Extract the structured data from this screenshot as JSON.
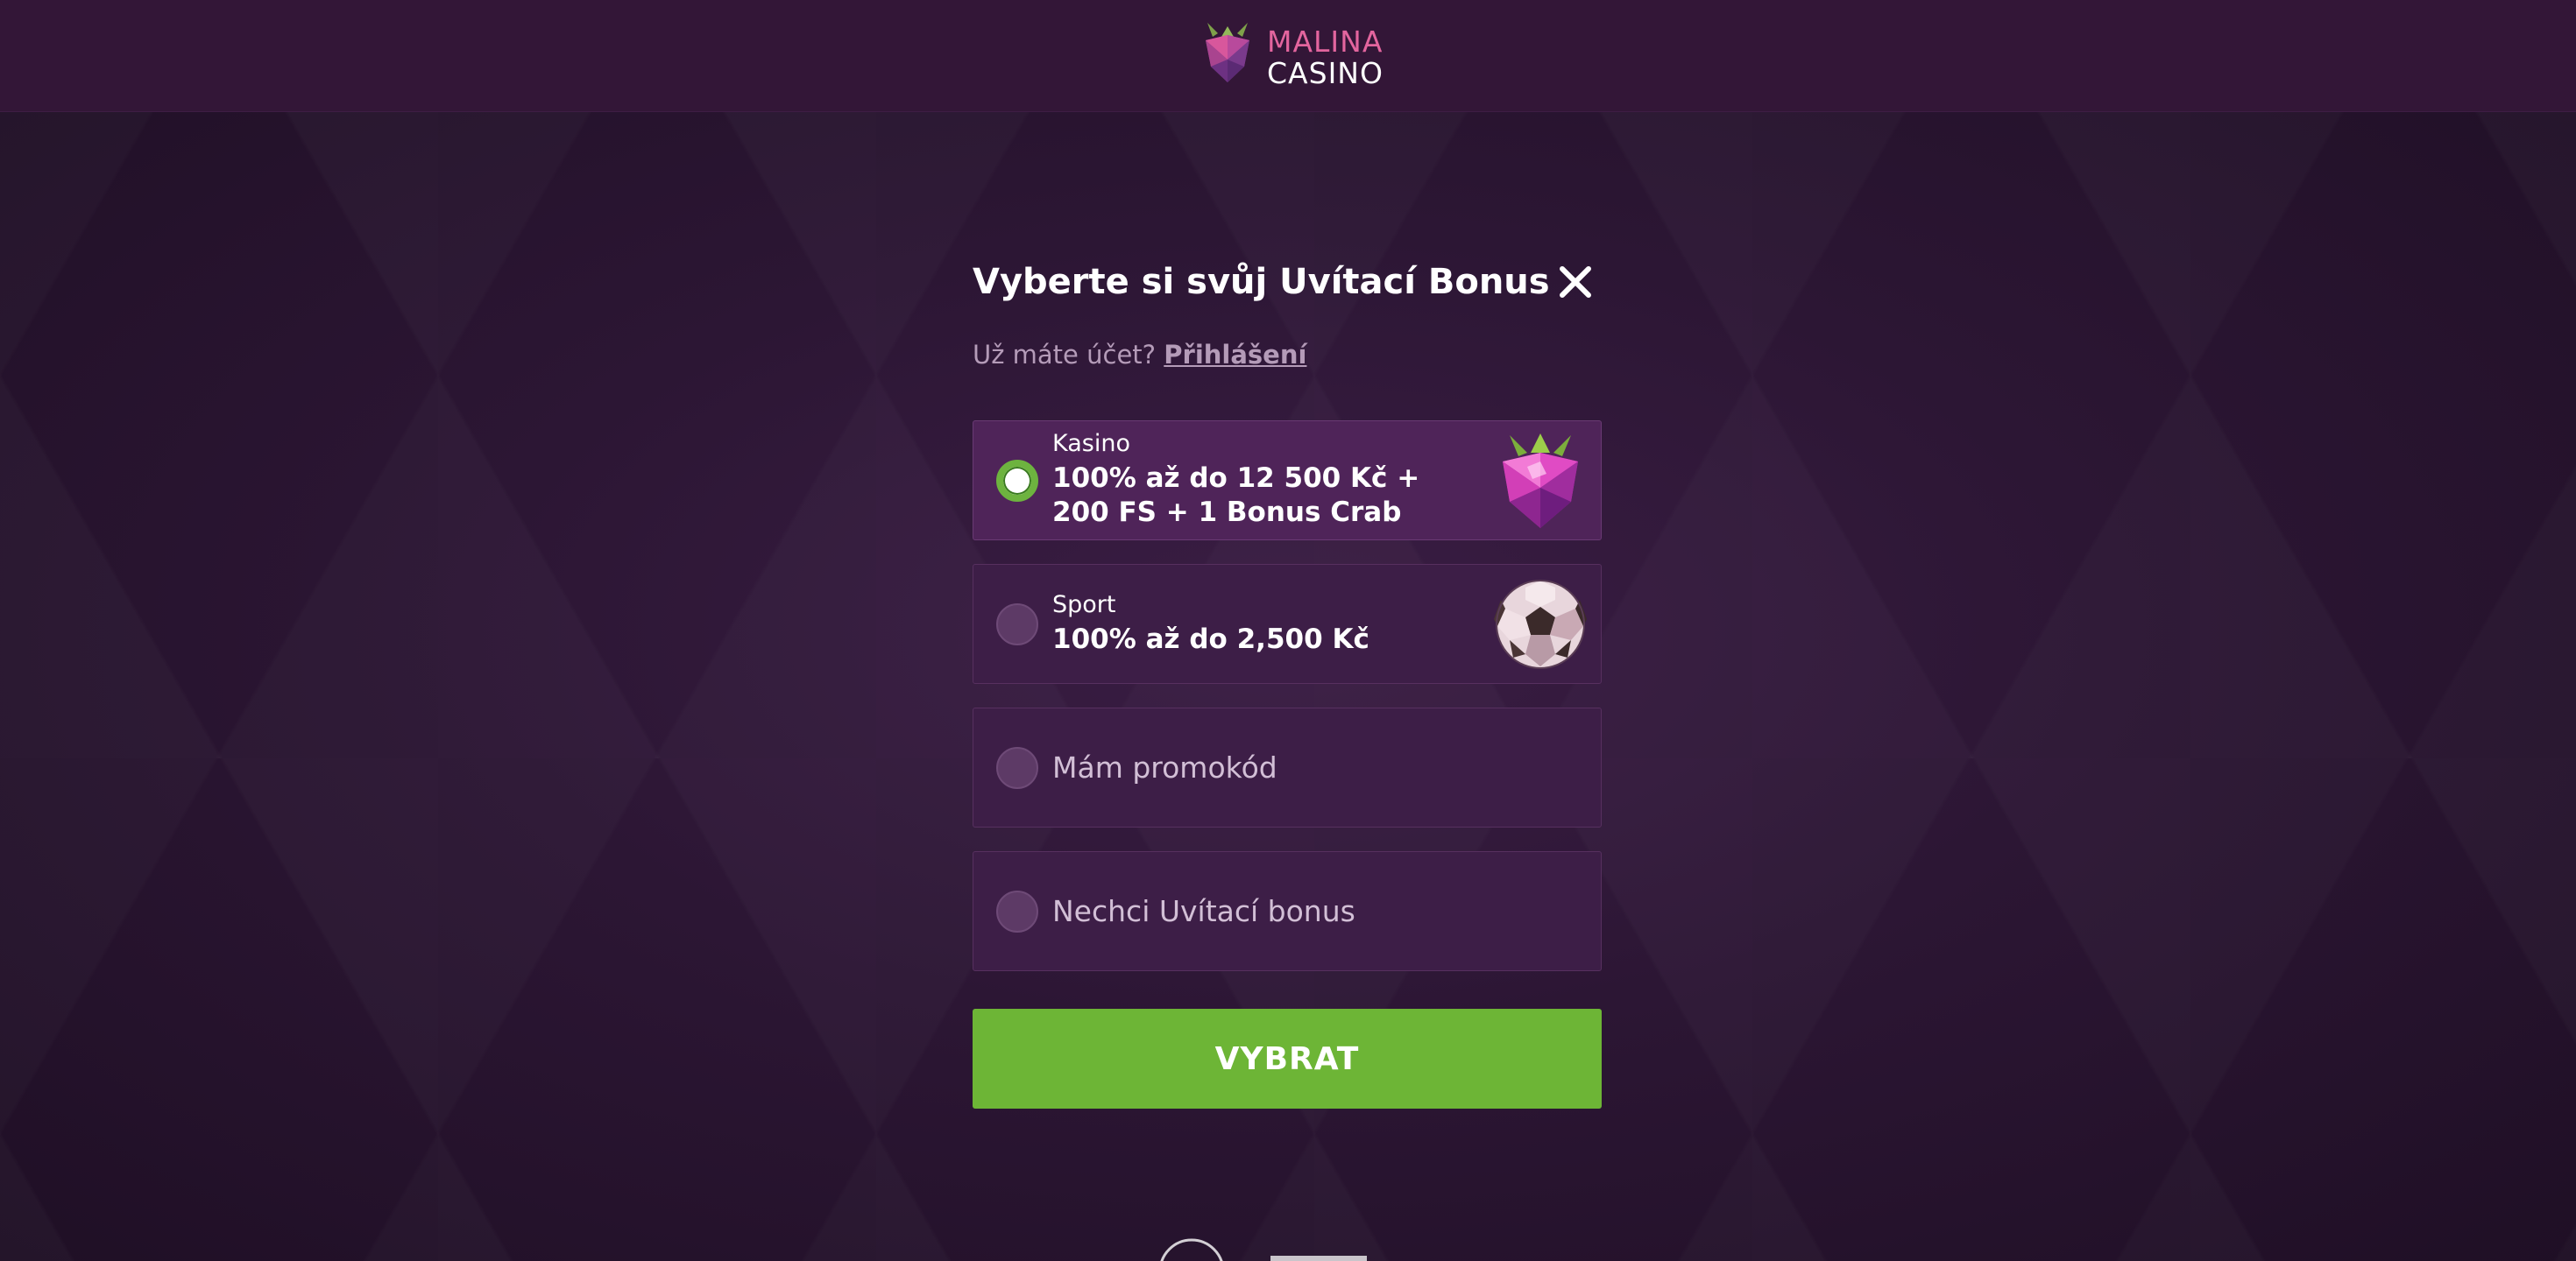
{
  "header": {
    "logo_line1": "MALINA",
    "logo_line2": "CASINO"
  },
  "modal": {
    "title": "Vyberte si svůj Uvítací Bonus",
    "account_question": "Už máte účet?",
    "login_link": "Přihlášení",
    "options": [
      {
        "category": "Kasino",
        "offer": "100% až do 12 500 Kč + 200 FS + 1 Bonus Crab",
        "selected": true,
        "art": "raspberry-gem-icon"
      },
      {
        "category": "Sport",
        "offer": "100% až do 2,500 Kč",
        "selected": false,
        "art": "soccer-ball-icon"
      },
      {
        "label": "Mám promokód",
        "selected": false
      },
      {
        "label": "Nechci Uvítací bonus",
        "selected": false
      }
    ],
    "submit_label": "VYBRAT"
  },
  "colors": {
    "accent_green": "#6db536",
    "brand_pink": "#e3659e",
    "panel": "#3d1e47",
    "background": "#2c1634"
  }
}
